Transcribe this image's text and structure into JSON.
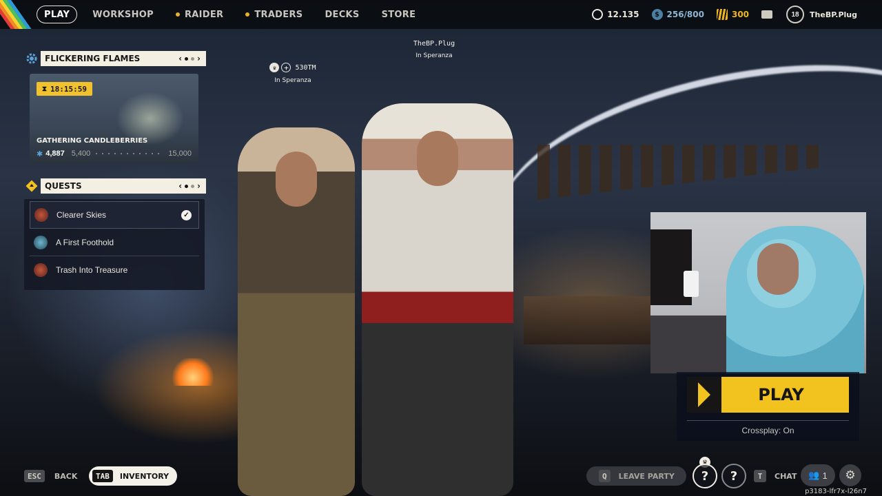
{
  "topbar": {
    "nav": [
      {
        "label": "PLAY",
        "active": true,
        "dot": false
      },
      {
        "label": "WORKSHOP",
        "active": false,
        "dot": false
      },
      {
        "label": "RAIDER",
        "active": false,
        "dot": true
      },
      {
        "label": "TRADERS",
        "active": false,
        "dot": true
      },
      {
        "label": "DECKS",
        "active": false,
        "dot": false
      },
      {
        "label": "STORE",
        "active": false,
        "dot": false
      }
    ],
    "coins": "12.135",
    "credits": "256/800",
    "tokens": "300",
    "level": "18",
    "username": "TheBP.Plug",
    "stripe_colors": [
      "#e23b3b",
      "#f08a24",
      "#f6d233",
      "#4fbf5a",
      "#2f9ad8"
    ]
  },
  "event": {
    "title": "FLICKERING FLAMES",
    "timer": "18:15:59",
    "name": "GATHERING CANDLEBERRIES",
    "current": "4,887",
    "milestone": "5,400",
    "goal": "15,000"
  },
  "quests": {
    "title": "QUESTS",
    "items": [
      {
        "label": "Clearer Skies",
        "done": true,
        "color": "#8a3b2c"
      },
      {
        "label": "A First Foothold",
        "done": false,
        "color": "#3a7f9a"
      },
      {
        "label": "Trash Into Treasure",
        "done": false,
        "color": "#8a3b2c"
      }
    ]
  },
  "players": {
    "left": {
      "tag": "530TM",
      "status": "In Speranza"
    },
    "right": {
      "tag": "TheBP.Plug",
      "status": "In Speranza"
    }
  },
  "play": {
    "label": "PLAY",
    "crossplay": "Crossplay: On"
  },
  "bottom": {
    "back_key": "ESC",
    "back_label": "BACK",
    "inv_key": "TAB",
    "inv_label": "INVENTORY",
    "leave_key": "Q",
    "leave_label": "LEAVE PARTY",
    "help1": "?",
    "help2": "?",
    "chat_key": "T",
    "chat_label": "CHAT",
    "party_count": "1"
  },
  "session_id": "p3183-lfr7x-l26n7",
  "accent": "#f2c21f"
}
